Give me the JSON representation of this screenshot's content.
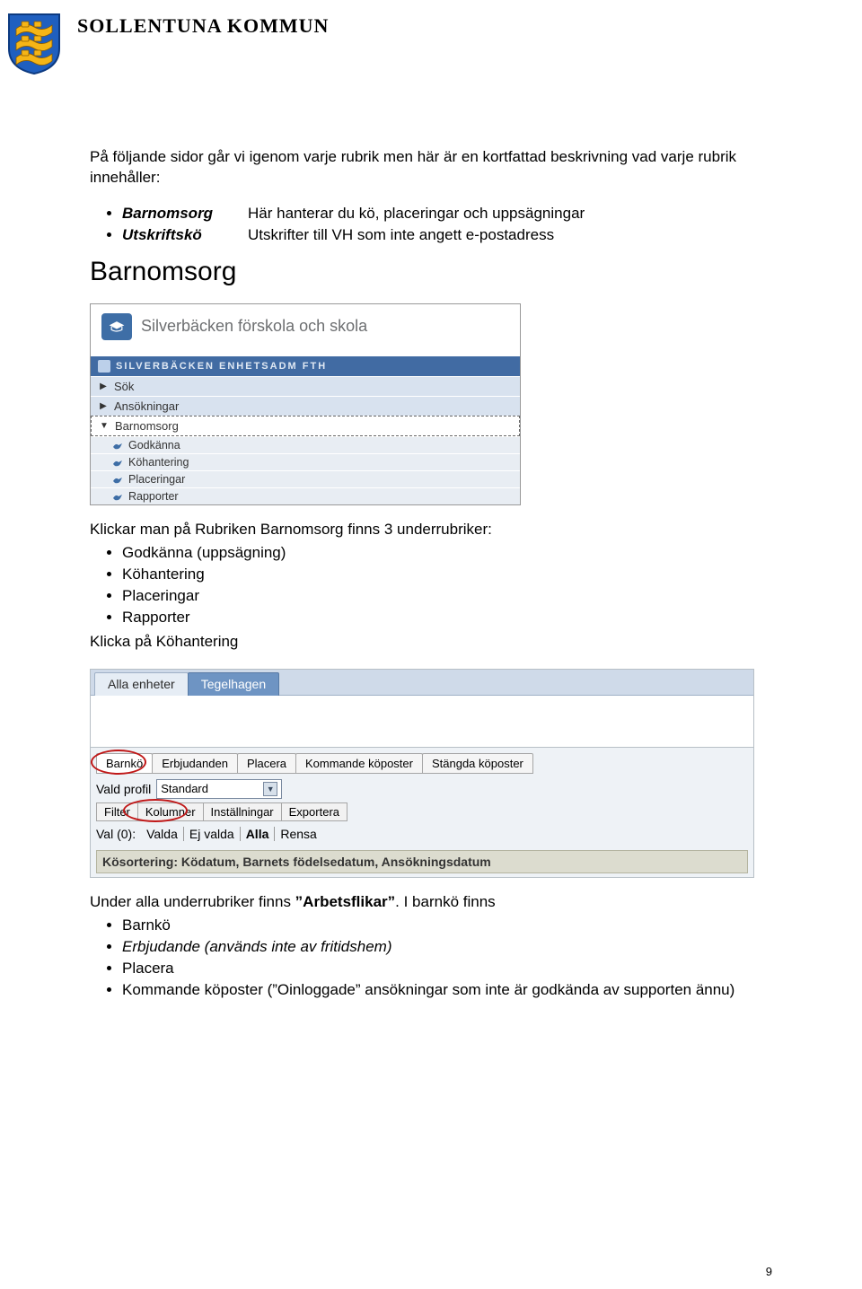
{
  "header": {
    "kommun": "SOLLENTUNA KOMMUN"
  },
  "intro": "På följande sidor går vi igenom varje rubrik men här är en kortfattad beskrivning vad varje rubrik innehåller:",
  "defs": [
    {
      "term": "Barnomsorg",
      "desc": "Här hanterar du kö, placeringar och uppsägningar"
    },
    {
      "term": "Utskriftskö",
      "desc": "Utskrifter till VH som inte angett e-postadress"
    }
  ],
  "section_heading": "Barnomsorg",
  "ss1": {
    "banner": "Silverbäcken förskola och skola",
    "user": "SILVERBÄCKEN ENHETSADM FTH",
    "items": [
      "Sök",
      "Ansökningar"
    ],
    "selected": "Barnomsorg",
    "subs": [
      "Godkänna",
      "Köhantering",
      "Placeringar",
      "Rapporter"
    ]
  },
  "mid_para": "Klickar man på Rubriken Barnomsorg finns 3 underrubriker:",
  "mid_bullets": [
    "Godkänna (uppsägning)",
    "Köhantering",
    "Placeringar",
    "Rapporter"
  ],
  "mid_footer": "Klicka på Köhantering",
  "ss2": {
    "top_tabs": [
      "Alla enheter",
      "Tegelhagen"
    ],
    "sub_tabs": [
      "Barnkö",
      "Erbjudanden",
      "Placera",
      "Kommande köposter",
      "Stängda köposter"
    ],
    "profile_label": "Vald profil",
    "profile_value": "Standard",
    "tool_btns": [
      "Filter",
      "Kolumner",
      "Inställningar",
      "Exportera"
    ],
    "val_label": "Val (0):",
    "val_opts": [
      "Valda",
      "Ej valda",
      "Alla",
      "Rensa"
    ],
    "sort_label": "Kösortering: Ködatum, Barnets födelsedatum, Ansökningsdatum"
  },
  "end_para_a": "Under alla underrubriker finns ",
  "end_para_b": "”Arbetsflikar”",
  "end_para_c": ". I barnkö finns",
  "end_bullets": [
    {
      "t": "Barnkö",
      "it": false
    },
    {
      "t": "Erbjudande (används inte av fritidshem)",
      "it": true
    },
    {
      "t": "Placera",
      "it": false
    },
    {
      "t": "Kommande köposter (”Oinloggade” ansökningar som inte är godkända av supporten ännu)",
      "it": false
    }
  ],
  "page_number": "9"
}
